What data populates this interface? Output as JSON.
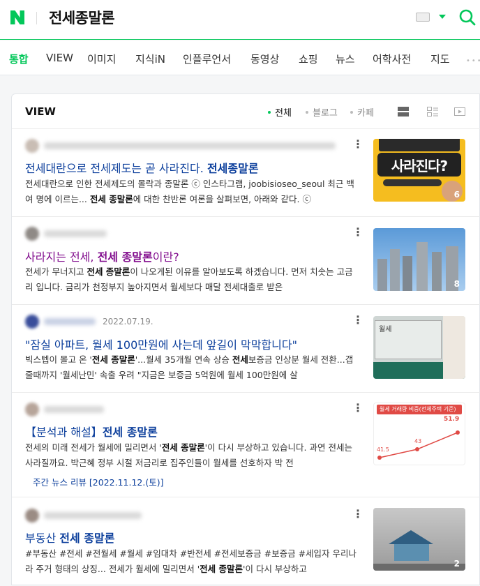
{
  "header": {
    "query": "전세종말론",
    "brand_color": "#03c75a"
  },
  "tabs": [
    {
      "label": "통합",
      "active": true
    },
    {
      "label": "VIEW"
    },
    {
      "label": "이미지"
    },
    {
      "label": "지식iN"
    },
    {
      "label": "인플루언서"
    },
    {
      "label": "동영상"
    },
    {
      "label": "쇼핑"
    },
    {
      "label": "뉴스"
    },
    {
      "label": "어학사전"
    },
    {
      "label": "지도"
    }
  ],
  "view": {
    "title": "VIEW",
    "filters": [
      "전체",
      "블로그",
      "카페"
    ],
    "active_filter": "전체"
  },
  "results": [
    {
      "title_plain": "전세대란으로 전세제도는 곧 사라진다. ",
      "title_bold": "전세종말론",
      "title_after": "",
      "desc_html": "전세대란으로 인한 전세제도의 몰락과 종말론 ⓒ 인스타그램, joobisioseo_seoul 최근 백여 명에 이르는... <b>전세 종말론</b>에 대한 찬반론 여론을 살펴보면, 아래와 같다. ⓒ",
      "thumb_count": "6",
      "thumb_text": "사라진다?"
    },
    {
      "title_plain": "사라지는 전세, ",
      "title_bold": "전세 종말론",
      "title_after": "이란?",
      "visited": true,
      "desc_html": "전세가 무너지고 <b>전세 종말론</b>이 나오게된 이유를 알아보도록 하겠습니다. 먼저 치솟는 고금리 입니다. 금리가 천정부지 높아지면서 월세보다 매달 전세대출로 받은",
      "thumb_count": "8"
    },
    {
      "date": "2022.07.19.",
      "title_plain": "\"잠실 아파트, 월세 100만원에 사는데 앞길이 막막합니다\"",
      "title_bold": "",
      "title_after": "",
      "desc_html": "빅스텝이 몰고 온 '<b>전세 종말론</b>'...월세 35개월 연속 상승 <b>전세</b>보증금 인상분 월세 전환...갭 줄때까지 '월세난민' 속출 우려 \"지금은 보증금 5억원에 월세 100만원에 살",
      "thumb_text": "월세"
    },
    {
      "title_plain": "【분석과 해설】",
      "title_bold": "전세 종말론",
      "title_after": "",
      "desc_html": "전세의 미래 전세가 월세에 밀리면서 '<b>전세 종말론</b>'이 다시 부상하고 있습니다. 과연 전세는 사라질까요. 박근혜 정부 시절 저금리로 집주인들이 월세를 선호하자 박 전",
      "source": "주간 뉴스 리뷰 [2022.11.12.(토)]",
      "thumb_caption": "월세 거래량 비중(전체주택 기준)",
      "thumb_values": [
        "41.5",
        "43",
        "51.9"
      ]
    },
    {
      "title_plain": "부동산 ",
      "title_bold": "전세 종말론",
      "title_after": "",
      "desc_html": "#부동산 #전세 #전월세 #월세 #임대차 #반전세 #전세보증금 #보증금 #세입자 우리나라 주거 형태의 상징... 전세가 월세에 밀리면서 '<b>전세 종말론</b>'이 다시 부상하고",
      "thumb_count": "2"
    }
  ]
}
